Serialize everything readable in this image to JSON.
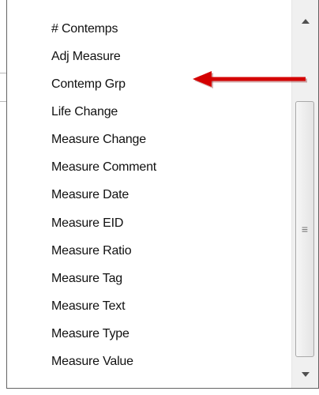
{
  "dropdown": {
    "items": [
      "# Contemps",
      "Adj Measure",
      "Contemp Grp",
      "Life Change",
      "Measure Change",
      "Measure Comment",
      "Measure Date",
      "Measure EID",
      "Measure Ratio",
      "Measure Tag",
      "Measure Text",
      "Measure Type",
      "Measure Value"
    ]
  },
  "scrollbar": {
    "up_icon": "triangle-up",
    "down_icon": "triangle-down",
    "grip_icon": "grip-lines"
  },
  "annotation": {
    "arrow_color": "#d40000",
    "arrow_points_to": "Contemp Grp"
  }
}
